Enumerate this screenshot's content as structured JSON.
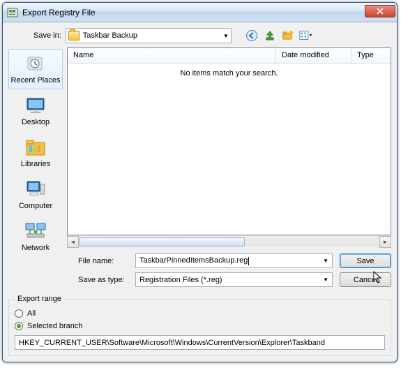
{
  "title": "Export Registry File",
  "save_in_label": "Save in:",
  "save_in_value": "Taskbar Backup",
  "columns": {
    "name": "Name",
    "date": "Date modified",
    "type": "Type"
  },
  "empty_msg": "No items match your search.",
  "places": {
    "recent": "Recent Places",
    "desktop": "Desktop",
    "libraries": "Libraries",
    "computer": "Computer",
    "network": "Network"
  },
  "filename_label": "File name:",
  "filename_value": "TaskbarPinnedItemsBackup.reg",
  "saveas_label": "Save as type:",
  "saveas_value": "Registration Files (*.reg)",
  "btn_save": "Save",
  "btn_cancel": "Cancel",
  "export_range": {
    "legend": "Export range",
    "all": "All",
    "selected": "Selected branch",
    "branch": "HKEY_CURRENT_USER\\Software\\Microsoft\\Windows\\CurrentVersion\\Explorer\\Taskband"
  }
}
